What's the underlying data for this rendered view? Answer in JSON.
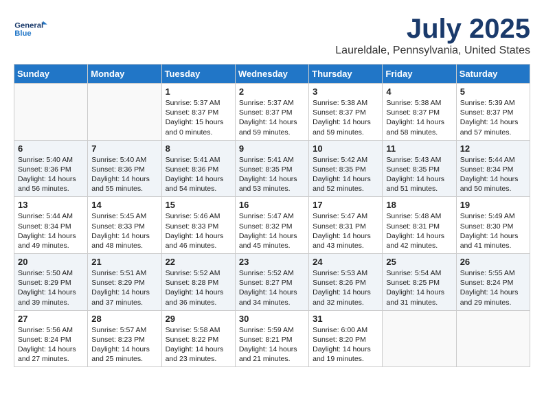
{
  "logo": {
    "line1": "General",
    "line2": "Blue"
  },
  "title": "July 2025",
  "location": "Laureldale, Pennsylvania, United States",
  "weekdays": [
    "Sunday",
    "Monday",
    "Tuesday",
    "Wednesday",
    "Thursday",
    "Friday",
    "Saturday"
  ],
  "weeks": [
    [
      {
        "day": null
      },
      {
        "day": null
      },
      {
        "day": "1",
        "sunrise": "Sunrise: 5:37 AM",
        "sunset": "Sunset: 8:37 PM",
        "daylight": "Daylight: 15 hours and 0 minutes."
      },
      {
        "day": "2",
        "sunrise": "Sunrise: 5:37 AM",
        "sunset": "Sunset: 8:37 PM",
        "daylight": "Daylight: 14 hours and 59 minutes."
      },
      {
        "day": "3",
        "sunrise": "Sunrise: 5:38 AM",
        "sunset": "Sunset: 8:37 PM",
        "daylight": "Daylight: 14 hours and 59 minutes."
      },
      {
        "day": "4",
        "sunrise": "Sunrise: 5:38 AM",
        "sunset": "Sunset: 8:37 PM",
        "daylight": "Daylight: 14 hours and 58 minutes."
      },
      {
        "day": "5",
        "sunrise": "Sunrise: 5:39 AM",
        "sunset": "Sunset: 8:37 PM",
        "daylight": "Daylight: 14 hours and 57 minutes."
      }
    ],
    [
      {
        "day": "6",
        "sunrise": "Sunrise: 5:40 AM",
        "sunset": "Sunset: 8:36 PM",
        "daylight": "Daylight: 14 hours and 56 minutes."
      },
      {
        "day": "7",
        "sunrise": "Sunrise: 5:40 AM",
        "sunset": "Sunset: 8:36 PM",
        "daylight": "Daylight: 14 hours and 55 minutes."
      },
      {
        "day": "8",
        "sunrise": "Sunrise: 5:41 AM",
        "sunset": "Sunset: 8:36 PM",
        "daylight": "Daylight: 14 hours and 54 minutes."
      },
      {
        "day": "9",
        "sunrise": "Sunrise: 5:41 AM",
        "sunset": "Sunset: 8:35 PM",
        "daylight": "Daylight: 14 hours and 53 minutes."
      },
      {
        "day": "10",
        "sunrise": "Sunrise: 5:42 AM",
        "sunset": "Sunset: 8:35 PM",
        "daylight": "Daylight: 14 hours and 52 minutes."
      },
      {
        "day": "11",
        "sunrise": "Sunrise: 5:43 AM",
        "sunset": "Sunset: 8:35 PM",
        "daylight": "Daylight: 14 hours and 51 minutes."
      },
      {
        "day": "12",
        "sunrise": "Sunrise: 5:44 AM",
        "sunset": "Sunset: 8:34 PM",
        "daylight": "Daylight: 14 hours and 50 minutes."
      }
    ],
    [
      {
        "day": "13",
        "sunrise": "Sunrise: 5:44 AM",
        "sunset": "Sunset: 8:34 PM",
        "daylight": "Daylight: 14 hours and 49 minutes."
      },
      {
        "day": "14",
        "sunrise": "Sunrise: 5:45 AM",
        "sunset": "Sunset: 8:33 PM",
        "daylight": "Daylight: 14 hours and 48 minutes."
      },
      {
        "day": "15",
        "sunrise": "Sunrise: 5:46 AM",
        "sunset": "Sunset: 8:33 PM",
        "daylight": "Daylight: 14 hours and 46 minutes."
      },
      {
        "day": "16",
        "sunrise": "Sunrise: 5:47 AM",
        "sunset": "Sunset: 8:32 PM",
        "daylight": "Daylight: 14 hours and 45 minutes."
      },
      {
        "day": "17",
        "sunrise": "Sunrise: 5:47 AM",
        "sunset": "Sunset: 8:31 PM",
        "daylight": "Daylight: 14 hours and 43 minutes."
      },
      {
        "day": "18",
        "sunrise": "Sunrise: 5:48 AM",
        "sunset": "Sunset: 8:31 PM",
        "daylight": "Daylight: 14 hours and 42 minutes."
      },
      {
        "day": "19",
        "sunrise": "Sunrise: 5:49 AM",
        "sunset": "Sunset: 8:30 PM",
        "daylight": "Daylight: 14 hours and 41 minutes."
      }
    ],
    [
      {
        "day": "20",
        "sunrise": "Sunrise: 5:50 AM",
        "sunset": "Sunset: 8:29 PM",
        "daylight": "Daylight: 14 hours and 39 minutes."
      },
      {
        "day": "21",
        "sunrise": "Sunrise: 5:51 AM",
        "sunset": "Sunset: 8:29 PM",
        "daylight": "Daylight: 14 hours and 37 minutes."
      },
      {
        "day": "22",
        "sunrise": "Sunrise: 5:52 AM",
        "sunset": "Sunset: 8:28 PM",
        "daylight": "Daylight: 14 hours and 36 minutes."
      },
      {
        "day": "23",
        "sunrise": "Sunrise: 5:52 AM",
        "sunset": "Sunset: 8:27 PM",
        "daylight": "Daylight: 14 hours and 34 minutes."
      },
      {
        "day": "24",
        "sunrise": "Sunrise: 5:53 AM",
        "sunset": "Sunset: 8:26 PM",
        "daylight": "Daylight: 14 hours and 32 minutes."
      },
      {
        "day": "25",
        "sunrise": "Sunrise: 5:54 AM",
        "sunset": "Sunset: 8:25 PM",
        "daylight": "Daylight: 14 hours and 31 minutes."
      },
      {
        "day": "26",
        "sunrise": "Sunrise: 5:55 AM",
        "sunset": "Sunset: 8:24 PM",
        "daylight": "Daylight: 14 hours and 29 minutes."
      }
    ],
    [
      {
        "day": "27",
        "sunrise": "Sunrise: 5:56 AM",
        "sunset": "Sunset: 8:24 PM",
        "daylight": "Daylight: 14 hours and 27 minutes."
      },
      {
        "day": "28",
        "sunrise": "Sunrise: 5:57 AM",
        "sunset": "Sunset: 8:23 PM",
        "daylight": "Daylight: 14 hours and 25 minutes."
      },
      {
        "day": "29",
        "sunrise": "Sunrise: 5:58 AM",
        "sunset": "Sunset: 8:22 PM",
        "daylight": "Daylight: 14 hours and 23 minutes."
      },
      {
        "day": "30",
        "sunrise": "Sunrise: 5:59 AM",
        "sunset": "Sunset: 8:21 PM",
        "daylight": "Daylight: 14 hours and 21 minutes."
      },
      {
        "day": "31",
        "sunrise": "Sunrise: 6:00 AM",
        "sunset": "Sunset: 8:20 PM",
        "daylight": "Daylight: 14 hours and 19 minutes."
      },
      {
        "day": null
      },
      {
        "day": null
      }
    ]
  ]
}
